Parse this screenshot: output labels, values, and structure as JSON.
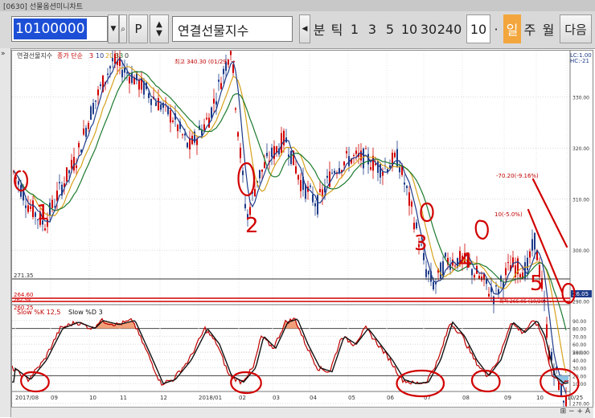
{
  "window": {
    "title": "[0630] 선물옵션미니차트"
  },
  "toolbar": {
    "code_value": "10100000",
    "p_button": "P",
    "name_value": "연결선물지수",
    "periods": [
      "분",
      "틱",
      "1",
      "3",
      "5",
      "10",
      "30",
      "240"
    ],
    "count_value": "10",
    "dot": "·",
    "day_label": "일",
    "week_label": "주",
    "month_label": "월",
    "next_label": "다음"
  },
  "main_panel": {
    "header": "연결선물지수",
    "header_sub": "종가 단순",
    "ma_labels": [
      "3",
      "10",
      "20",
      "33",
      "0"
    ],
    "ma_colors": [
      "#c00000",
      "#1f3c8a",
      "#d6a21c",
      "#1d7a2e",
      "#333333"
    ],
    "legend_right_1": "LC:1.00",
    "legend_right_2": "HC:-21",
    "high_annotation": "최고 340.30 (01/29) →",
    "peak_annotation": "-70.20(-9.16%)",
    "mid_annotation": "10(-5.0%)",
    "low_annotation": "최저 265.05 (10/29) →",
    "level_271": "271.35",
    "level_264": "264.60",
    "level_262": "262.59",
    "level_260": "260.25",
    "last_price_box": "26.05",
    "y_ticks": [
      "330.00",
      "320.00",
      "310.00",
      "300.00",
      "290.00",
      "280.00",
      "270.00"
    ]
  },
  "stoch_panel": {
    "label_k": "Slow %K 12,5",
    "label_d": "Slow %D 3",
    "y_ticks": [
      "90.00",
      "80.00",
      "70.00",
      "60.00",
      "50.00",
      "40.00",
      "30.00",
      "20.00",
      "10.00"
    ]
  },
  "x_axis": {
    "ticks": [
      "2017/08",
      "09",
      "10",
      "11",
      "12",
      "2018/01",
      "02",
      "03",
      "04",
      "05",
      "06",
      "07",
      "08",
      "09",
      "10",
      "10/25"
    ]
  },
  "annotations": {
    "numbers": [
      "1",
      "2",
      "3",
      "4",
      "5"
    ]
  },
  "side_icons": {
    "collapse": "»"
  },
  "colors": {
    "accent": "#f3a63d",
    "selection": "#1d4fd6",
    "marker": "#d10000"
  }
}
